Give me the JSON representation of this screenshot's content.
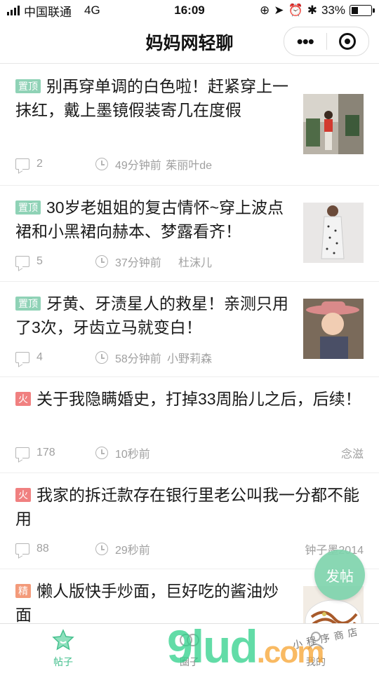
{
  "status": {
    "carrier": "中国联通",
    "network": "4G",
    "time": "16:09",
    "battery": "33%",
    "battery_level": 0.33
  },
  "nav": {
    "title": "妈妈网轻聊",
    "more": "•••"
  },
  "posts": [
    {
      "tag": "置顶",
      "title": "别再穿单调的白色啦！赶紧穿上一抹红，戴上墨镜假装寄几在度假",
      "comments": "2",
      "time": "49分钟前",
      "author": "茱丽叶de"
    },
    {
      "tag": "置顶",
      "title": "30岁老姐姐的复古情怀~穿上波点裙和小黑裙向赫本、梦露看齐！",
      "comments": "5",
      "time": "37分钟前",
      "author": "杜沫儿"
    },
    {
      "tag": "置顶",
      "title": "牙黄、牙渍星人的救星！亲测只用了3次，牙齿立马就变白！",
      "comments": "4",
      "time": "58分钟前",
      "author": "小野莉森"
    },
    {
      "tag": "火",
      "title": "关于我隐瞒婚史，打掉33周胎儿之后，后续！",
      "comments": "178",
      "time": "10秒前",
      "author": "念滋"
    },
    {
      "tag": "火",
      "title": "我家的拆迁款存在银行里老公叫我一分都不能用",
      "comments": "88",
      "time": "29秒前",
      "author": "钟子墨2014"
    },
    {
      "tag": "精",
      "title": "懒人版快手炒面，巨好吃的酱油炒面",
      "comments": "",
      "time": "",
      "author": ""
    }
  ],
  "fab": {
    "label": "发帖"
  },
  "tabs": [
    {
      "label": "帖子"
    },
    {
      "label": "圈子"
    },
    {
      "label": "我的"
    }
  ],
  "watermark": {
    "main": "9lud",
    "com": ".com",
    "sub": "小程序商店"
  }
}
